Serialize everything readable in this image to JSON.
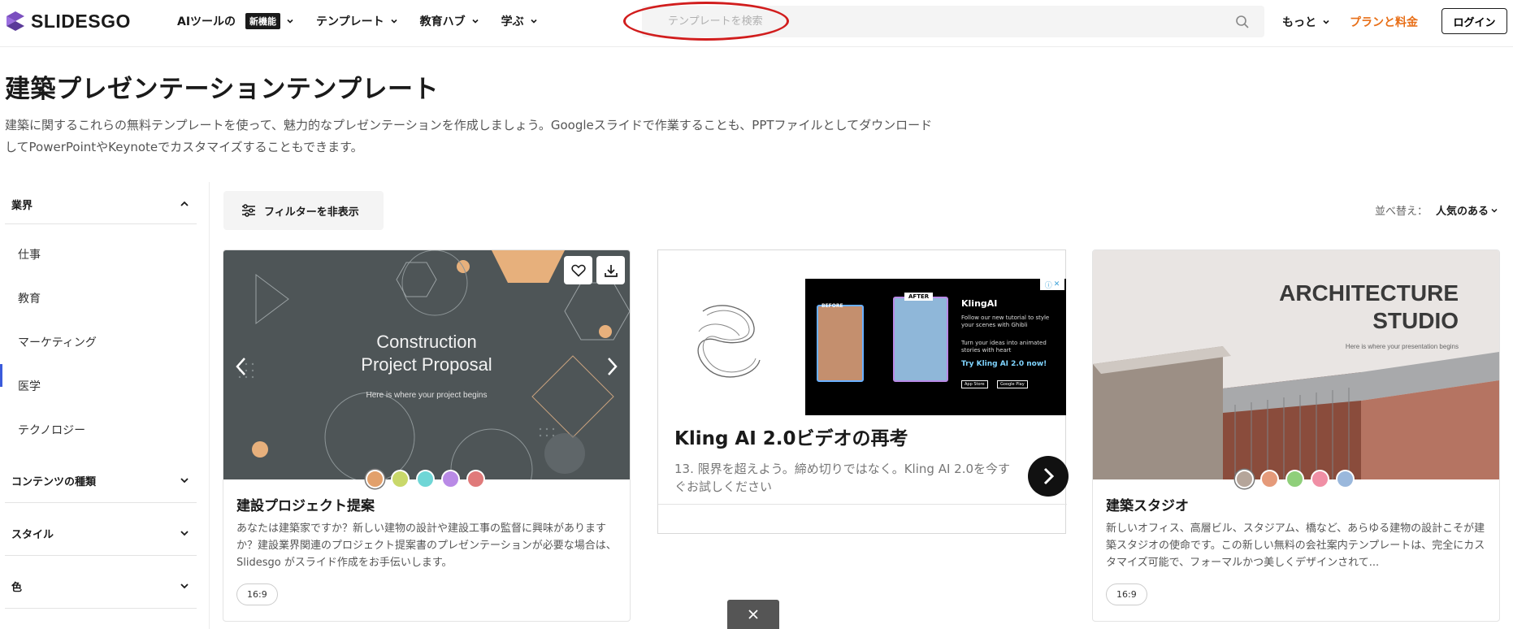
{
  "header": {
    "logo_text": "SLIDESGO",
    "nav": [
      {
        "label": "AIツールの",
        "badge": "新機能"
      },
      {
        "label": "テンプレート"
      },
      {
        "label": "教育ハブ"
      },
      {
        "label": "学ぶ"
      }
    ],
    "search_placeholder": "テンプレートを検索",
    "more_label": "もっと",
    "pricing_label": "プランと料金",
    "login_label": "ログイン",
    "annotation_color": "#d11d1d",
    "accent_color": "#e86f18"
  },
  "page": {
    "title": "建築プレゼンテーションテンプレート",
    "description_line1": "建築に関するこれらの無料テンプレートを使って、魅力的なプレゼンテーションを作成しましょう。Googleスライドで作業することも、PPTファイルとしてダウンロード",
    "description_line2": "してPowerPointやKeynoteでカスタマイズすることもできます。"
  },
  "sidebar": {
    "industry": {
      "heading": "業界",
      "items": [
        "仕事",
        "教育",
        "マーケティング",
        "医学",
        "テクノロジー"
      ],
      "active_item": "医学"
    },
    "content_type": "コンテンツの種類",
    "style": "スタイル",
    "color": "色"
  },
  "toolbar": {
    "filter_label": "フィルターを非表示",
    "sort_label": "並べ替え：",
    "sort_value": "人気のある"
  },
  "cards": [
    {
      "slide_title_line1": "Construction",
      "slide_title_line2": "Project Proposal",
      "slide_subtitle": "Here is where your project begins",
      "title": "建設プロジェクト提案",
      "description": "あなたは建築家ですか？新しい建物の設計や建設工事の監督に興味がありますか？建設業界関連のプロジェクト提案書のプレゼンテーションが必要な場合は、Slidesgo がスライド作成をお手伝いします。",
      "ratio": "16:9",
      "swatches": [
        "#e2a06b",
        "#c9d86a",
        "#6fd6d6",
        "#b98ae6",
        "#e07a7a"
      ]
    },
    {
      "slide_title_line1": "ARCHITECTURE",
      "slide_title_line2": "STUDIO",
      "slide_subtitle": "Here is where your presentation begins",
      "title": "建築スタジオ",
      "description": "新しいオフィス、高層ビル、スタジアム、橋など、あらゆる建物の設計こそが建築スタジオの使命です。この新しい無料の会社案内テンプレートは、完全にカスタマイズ可能で、フォーマルかつ美しくデザインされて...",
      "ratio": "16:9",
      "swatches": [
        "#b5a59a",
        "#e59a7a",
        "#8fcf7a",
        "#f08fa5",
        "#9ab8dc"
      ]
    }
  ],
  "ad": {
    "title": "Kling AI 2.0ビデオの再考",
    "description": "13. 限界を超えよう。締め切りではなく。Kling AI 2.0を今すぐお試しください",
    "banner": {
      "before_label": "BEFORE",
      "after_label": "AFTER",
      "brand": "KlingAI",
      "text1": "Follow our new tutorial to style your scenes with Ghibli",
      "text2": "Turn your ideas into animated stories with heart",
      "cta": "Try Kling AI 2.0 now!",
      "store1": "App Store",
      "store2": "Google Play"
    }
  }
}
